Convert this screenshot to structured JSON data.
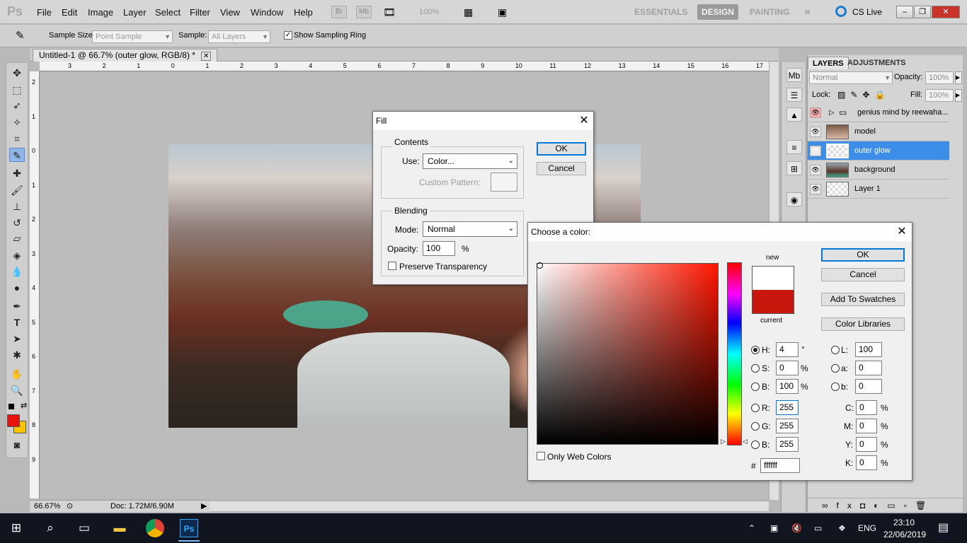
{
  "app": {
    "logo": "Ps",
    "menus": [
      "File",
      "Edit",
      "Image",
      "Layer",
      "Select",
      "Filter",
      "View",
      "Window",
      "Help"
    ],
    "mini_buttons": [
      "Br",
      "Mb"
    ],
    "zoom_menu": "100%",
    "workspaces": [
      "ESSENTIALS",
      "DESIGN",
      "PAINTING"
    ],
    "more_ws": "»",
    "cslive": "CS Live"
  },
  "options": {
    "sample_size_label": "Sample Size:",
    "sample_size_value": "Point Sample",
    "sample_label": "Sample:",
    "sample_value": "All Layers",
    "show_ring_label": "Show Sampling Ring"
  },
  "document": {
    "tab_title": "Untitled-1 @ 66.7% (outer glow, RGB/8) *",
    "zoom": "66.67%",
    "doc_info": "Doc: 1.72M/6.90M",
    "ruler_h": [
      "3",
      "2",
      "1",
      "0",
      "1",
      "2",
      "3",
      "4",
      "5",
      "6",
      "7",
      "8",
      "9",
      "10",
      "11",
      "12",
      "13",
      "14",
      "15",
      "16",
      "17"
    ],
    "ruler_v": [
      "2",
      "1",
      "0",
      "1",
      "2",
      "3",
      "4",
      "5",
      "6",
      "7",
      "8",
      "9"
    ]
  },
  "layers_panel": {
    "tabs": [
      "LAYERS",
      "ADJUSTMENTS"
    ],
    "blend": "Normal",
    "opacity_label": "Opacity:",
    "opacity": "100%",
    "lock_label": "Lock:",
    "fill_label": "Fill:",
    "fill": "100%",
    "layers": [
      {
        "name": "genius mind by reewaha...",
        "type": "group"
      },
      {
        "name": "model",
        "type": "image"
      },
      {
        "name": "outer glow",
        "type": "empty",
        "selected": true
      },
      {
        "name": "background",
        "type": "image"
      },
      {
        "name": "Layer 1",
        "type": "empty"
      }
    ]
  },
  "fill_dialog": {
    "title": "Fill",
    "ok": "OK",
    "cancel": "Cancel",
    "contents_label": "Contents",
    "use_label": "Use:",
    "use_value": "Color...",
    "custom_pattern_label": "Custom Pattern:",
    "blending_label": "Blending",
    "mode_label": "Mode:",
    "mode_value": "Normal",
    "opacity_label": "Opacity:",
    "opacity_value": "100",
    "opacity_unit": "%",
    "preserve_label": "Preserve Transparency"
  },
  "color_dialog": {
    "title": "Choose a color:",
    "ok": "OK",
    "cancel": "Cancel",
    "add_swatches": "Add To Swatches",
    "color_libraries": "Color Libraries",
    "new_label": "new",
    "current_label": "current",
    "new_color": "#ffffff",
    "current_color": "#c8180e",
    "hue_color": "#ff1500",
    "fields": {
      "H": "4",
      "S": "0",
      "B": "100",
      "R": "255",
      "G": "255",
      "B2": "255",
      "L": "100",
      "a": "0",
      "b": "0",
      "C": "0",
      "M": "0",
      "Y": "0",
      "K": "0"
    },
    "labels": {
      "H": "H:",
      "S": "S:",
      "B": "B:",
      "R": "R:",
      "G": "G:",
      "B2": "B:",
      "L": "L:",
      "a": "a:",
      "b": "b:",
      "C": "C:",
      "M": "M:",
      "Y": "Y:",
      "K": "K:"
    },
    "deg": "°",
    "pct": "%",
    "hash": "#",
    "hex": "ffffff",
    "only_web": "Only Web Colors"
  },
  "taskbar": {
    "lang": "ENG",
    "time": "23:10",
    "date": "22/06/2019"
  }
}
